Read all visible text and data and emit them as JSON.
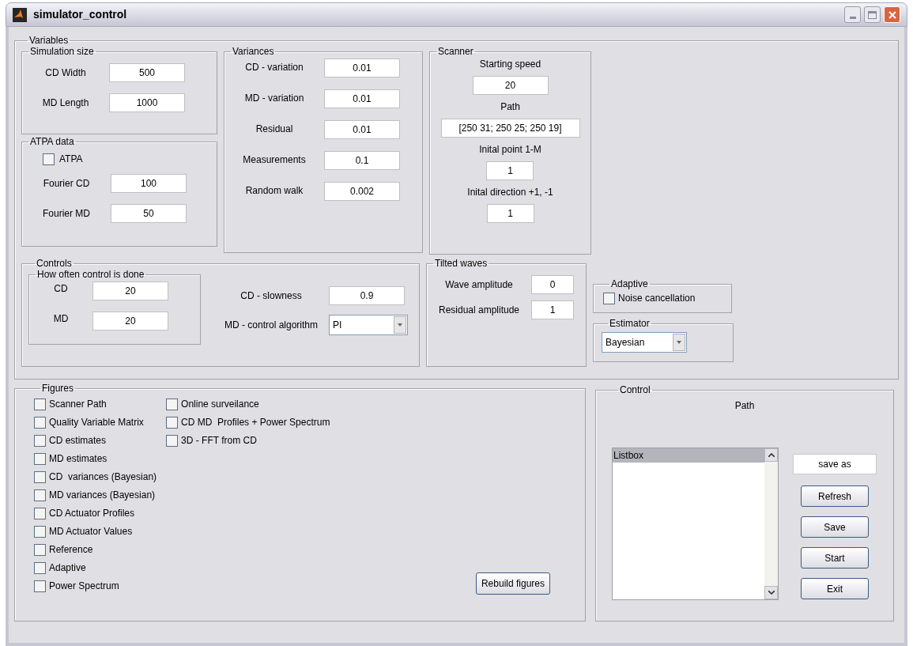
{
  "window": {
    "title": "simulator_control"
  },
  "variables": {
    "title": "Variables",
    "simulation_size": {
      "title": "Simulation size",
      "fields": [
        {
          "label": "CD Width",
          "value": "500"
        },
        {
          "label": "MD Length",
          "value": "1000"
        }
      ]
    },
    "atpa_data": {
      "title": "ATPA data",
      "checkbox": {
        "label": "ATPA",
        "checked": false
      },
      "fields": [
        {
          "label": "Fourier CD",
          "value": "100"
        },
        {
          "label": "Fourier MD",
          "value": "50"
        }
      ]
    },
    "variances": {
      "title": "Variances",
      "fields": [
        {
          "label": "CD - variation",
          "value": "0.01"
        },
        {
          "label": "MD - variation",
          "value": "0.01"
        },
        {
          "label": "Residual",
          "value": "0.01"
        },
        {
          "label": "Measurements",
          "value": "0.1"
        },
        {
          "label": "Random walk",
          "value": "0.002"
        }
      ]
    },
    "scanner": {
      "title": "Scanner",
      "fields": [
        {
          "label": "Starting speed",
          "value": "20",
          "kind": "medium"
        },
        {
          "label": "Path",
          "value": "[250 31; 250 25; 250 19]",
          "kind": "wide"
        },
        {
          "label": "Inital point 1-M",
          "value": "1",
          "kind": "small"
        },
        {
          "label": "Inital direction +1, -1",
          "value": "1",
          "kind": "small"
        }
      ]
    },
    "controls": {
      "title": "Controls",
      "frequency": {
        "title": "How often control is done",
        "fields": [
          {
            "label": "CD",
            "value": "20"
          },
          {
            "label": "MD",
            "value": "20"
          }
        ]
      },
      "cd_slowness": {
        "label": "CD - slowness",
        "value": "0.9"
      },
      "md_control_algorithm": {
        "label": "MD - control algorithm",
        "value": "PI"
      }
    },
    "tilted_waves": {
      "title": "Tilted waves",
      "fields": [
        {
          "label": "Wave amplitude",
          "value": "0"
        },
        {
          "label": "Residual amplitude",
          "value": "1"
        }
      ]
    },
    "adaptive": {
      "title": "Adaptive",
      "checkbox": {
        "label": "Noise cancellation",
        "checked": false
      }
    },
    "estimator": {
      "title": "Estimator",
      "value": "Bayesian"
    }
  },
  "figures": {
    "title": "Figures",
    "columns": [
      {
        "items": [
          {
            "label": "Scanner Path",
            "checked": false
          },
          {
            "label": "Quality Variable Matrix",
            "checked": false
          },
          {
            "label": "CD estimates",
            "checked": false
          },
          {
            "label": "MD estimates",
            "checked": false
          },
          {
            "label": "CD  variances (Bayesian)",
            "checked": false
          },
          {
            "label": "MD variances (Bayesian)",
            "checked": false
          },
          {
            "label": "CD Actuator Profiles",
            "checked": false
          },
          {
            "label": "MD Actuator Values",
            "checked": false
          },
          {
            "label": "Reference",
            "checked": false
          },
          {
            "label": "Adaptive",
            "checked": false
          },
          {
            "label": "Power Spectrum",
            "checked": false
          }
        ]
      },
      {
        "items": [
          {
            "label": "Online surveilance",
            "checked": false
          },
          {
            "label": "CD MD  Profiles + Power Spectrum",
            "checked": false
          },
          {
            "label": "3D - FFT from CD",
            "checked": false
          }
        ]
      }
    ],
    "rebuild_button": "Rebuild figures"
  },
  "control": {
    "title": "Control",
    "path_label": "Path",
    "listbox": {
      "items": [
        {
          "label": "Listbox",
          "selected": true
        }
      ]
    },
    "save_as_field": {
      "value": "save as"
    },
    "buttons": [
      "Refresh",
      "Save",
      "Start",
      "Exit"
    ]
  }
}
